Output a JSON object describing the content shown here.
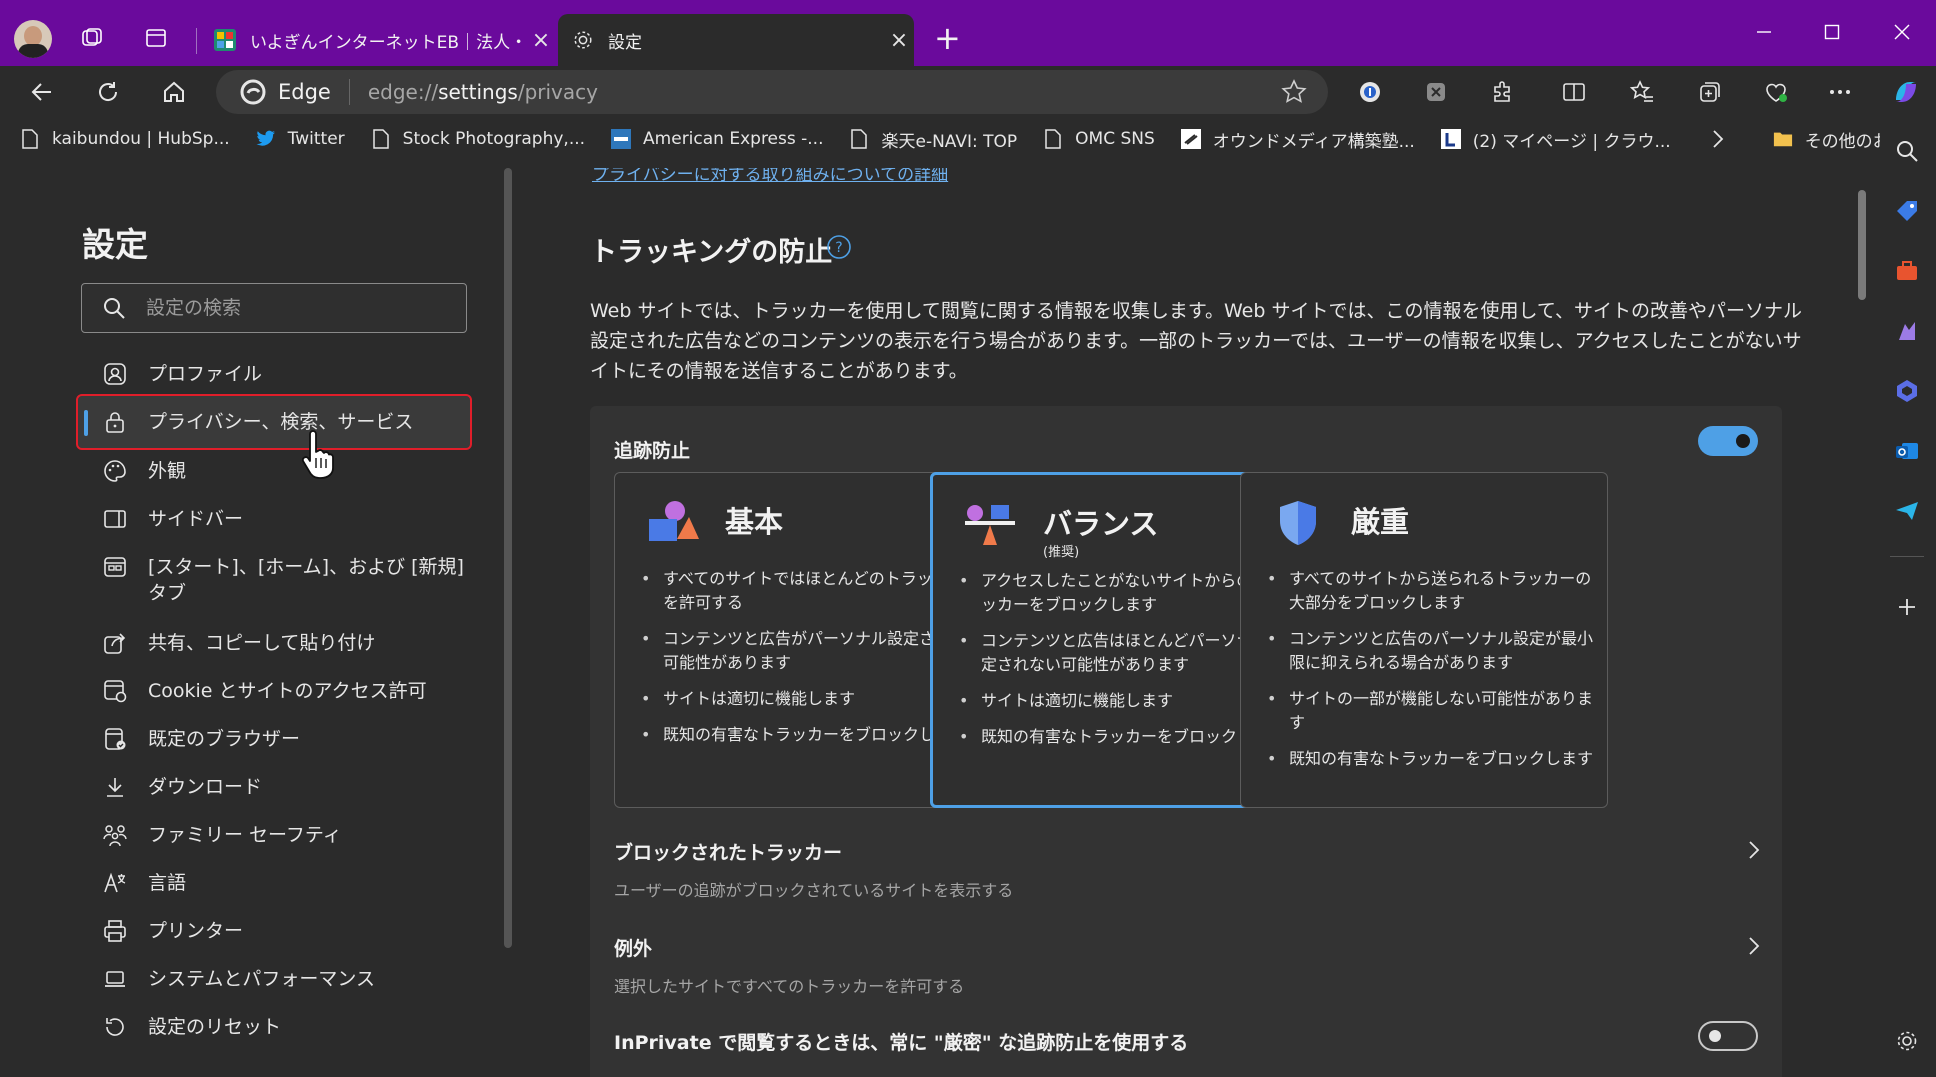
{
  "tabs": [
    {
      "label": "いよぎんインターネットEB｜法人・個人",
      "active": false
    },
    {
      "label": "設定",
      "active": true
    }
  ],
  "address": {
    "brand": "Edge",
    "url_prefix": "edge://",
    "url_bold": "settings",
    "url_suffix": "/privacy"
  },
  "favorites": [
    {
      "label": "kaibundou | HubSp...",
      "icon": "page-icon"
    },
    {
      "label": "Twitter",
      "icon": "twitter-icon"
    },
    {
      "label": "Stock Photography,...",
      "icon": "page-icon"
    },
    {
      "label": "American Express -...",
      "icon": "amex-icon"
    },
    {
      "label": "楽天e-NAVI: TOP",
      "icon": "page-icon"
    },
    {
      "label": "OMC SNS",
      "icon": "page-icon"
    },
    {
      "label": "オウンドメディア構築塾...",
      "icon": "owned-media-icon"
    },
    {
      "label": "(2) マイページ | クラウ...",
      "icon": "lancers-icon"
    }
  ],
  "favorites_other": "その他のお気に入り",
  "nav": {
    "title": "設定",
    "search_placeholder": "設定の検索",
    "items": [
      {
        "label": "プロファイル",
        "icon": "profile-icon"
      },
      {
        "label": "プライバシー、検索、サービス",
        "icon": "lock-icon",
        "active": true
      },
      {
        "label": "外観",
        "icon": "palette-icon"
      },
      {
        "label": "サイドバー",
        "icon": "sidebar-icon"
      },
      {
        "label": "[スタート]、[ホーム]、および [新規] タブ",
        "icon": "home-tab-icon"
      },
      {
        "label": "共有、コピーして貼り付け",
        "icon": "share-icon"
      },
      {
        "label": "Cookie とサイトのアクセス許可",
        "icon": "cookie-icon"
      },
      {
        "label": "既定のブラウザー",
        "icon": "browser-icon"
      },
      {
        "label": "ダウンロード",
        "icon": "download-icon"
      },
      {
        "label": "ファミリー セーフティ",
        "icon": "family-icon"
      },
      {
        "label": "言語",
        "icon": "language-icon"
      },
      {
        "label": "プリンター",
        "icon": "printer-icon"
      },
      {
        "label": "システムとパフォーマンス",
        "icon": "laptop-icon"
      },
      {
        "label": "設定のリセット",
        "icon": "reset-icon"
      }
    ]
  },
  "main": {
    "top_link": "プライバシーに対する取り組みについての詳細",
    "title": "トラッキングの防止",
    "description": "Web サイトでは、トラッカーを使用して閲覧に関する情報を収集します。Web サイトでは、この情報を使用して、サイトの改善やパーソナル設定された広告などのコンテンツの表示を行う場合があります。一部のトラッカーでは、ユーザーの情報を収集し、アクセスしたことがないサイトにその情報を送信することがあります。",
    "tracking_label": "追跡防止",
    "tracking_enabled": true,
    "options": [
      {
        "name": "基本",
        "sub": "",
        "bullets": [
          "すべてのサイトではほとんどのトラッカーを許可する",
          "コンテンツと広告がパーソナル設定される可能性があります",
          "サイトは適切に機能します",
          "既知の有害なトラッカーをブロックします"
        ]
      },
      {
        "name": "バランス",
        "sub": "(推奨)",
        "selected": true,
        "bullets": [
          "アクセスしたことがないサイトからのトラッカーをブロックします",
          "コンテンツと広告はほとんどパーソナル設定されない可能性があります",
          "サイトは適切に機能します",
          "既知の有害なトラッカーをブロックします"
        ]
      },
      {
        "name": "厳重",
        "sub": "",
        "bullets": [
          "すべてのサイトから送られるトラッカーの大部分をブロックします",
          "コンテンツと広告のパーソナル設定が最小限に抑えられる場合があります",
          "サイトの一部が機能しない可能性があります",
          "既知の有害なトラッカーをブロックします"
        ]
      }
    ],
    "blocked": {
      "title": "ブロックされたトラッカー",
      "desc": "ユーザーの追跡がブロックされているサイトを表示する"
    },
    "exceptions": {
      "title": "例外",
      "desc": "選択したサイトですべてのトラッカーを許可する"
    },
    "inprivate": {
      "title": "InPrivate で閲覧するときは、常に \"厳密\" な追跡防止を使用する",
      "enabled": false
    }
  },
  "colors": {
    "titlebar": "#6a0a9c",
    "accent": "#4ea0e6",
    "highlight_outline": "#e01e2a"
  }
}
